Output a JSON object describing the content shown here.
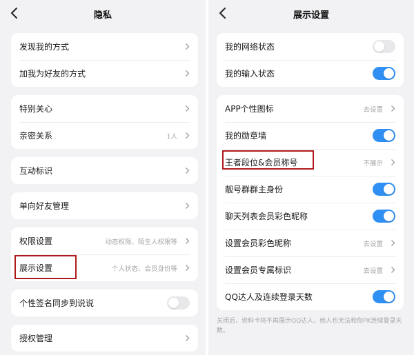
{
  "colors": {
    "accent": "#2f8ff3",
    "highlight": "#b0191c",
    "background": "#f2f2f4"
  },
  "privacy": {
    "title": "隐私",
    "back_icon": "chevron-left-icon",
    "find_me": "发现我的方式",
    "add_friend": "加我为好友的方式",
    "special_care": "特别关心",
    "intimate": "亲密关系",
    "intimate_value": "1人",
    "interaction_mark": "互动标识",
    "one_way_friends": "单向好友管理",
    "permissions": "权限设置",
    "permissions_value": "动态权限、陌生人权限等",
    "display_settings": "展示设置",
    "display_settings_value": "个人状态、会员身份等",
    "signature_sync": "个性签名同步到说说",
    "signature_sync_on": false,
    "authorization": "授权管理"
  },
  "display": {
    "title": "展示设置",
    "back_icon": "chevron-left-icon",
    "network_status": "我的网络状态",
    "network_status_on": false,
    "input_status": "我的输入状态",
    "input_status_on": true,
    "app_icon": "APP个性图标",
    "app_icon_value": "去设置",
    "medal_wall": "我的勋章墙",
    "medal_wall_on": true,
    "rank_member": "王者段位&会员称号",
    "rank_member_value": "不展示",
    "group_owner": "靓号群群主身份",
    "group_owner_on": true,
    "chat_nickname": "聊天列表会员彩色昵称",
    "chat_nickname_on": true,
    "member_nickname": "设置会员彩色昵称",
    "member_nickname_value": "去设置",
    "member_badge": "设置会员专属标识",
    "member_badge_value": "去设置",
    "qq_expert": "QQ达人及连续登录天数",
    "qq_expert_on": true,
    "footnote": "关闭后，资料卡将不再展示QQ达人，他人也无法和你PK连续登录天数。"
  }
}
